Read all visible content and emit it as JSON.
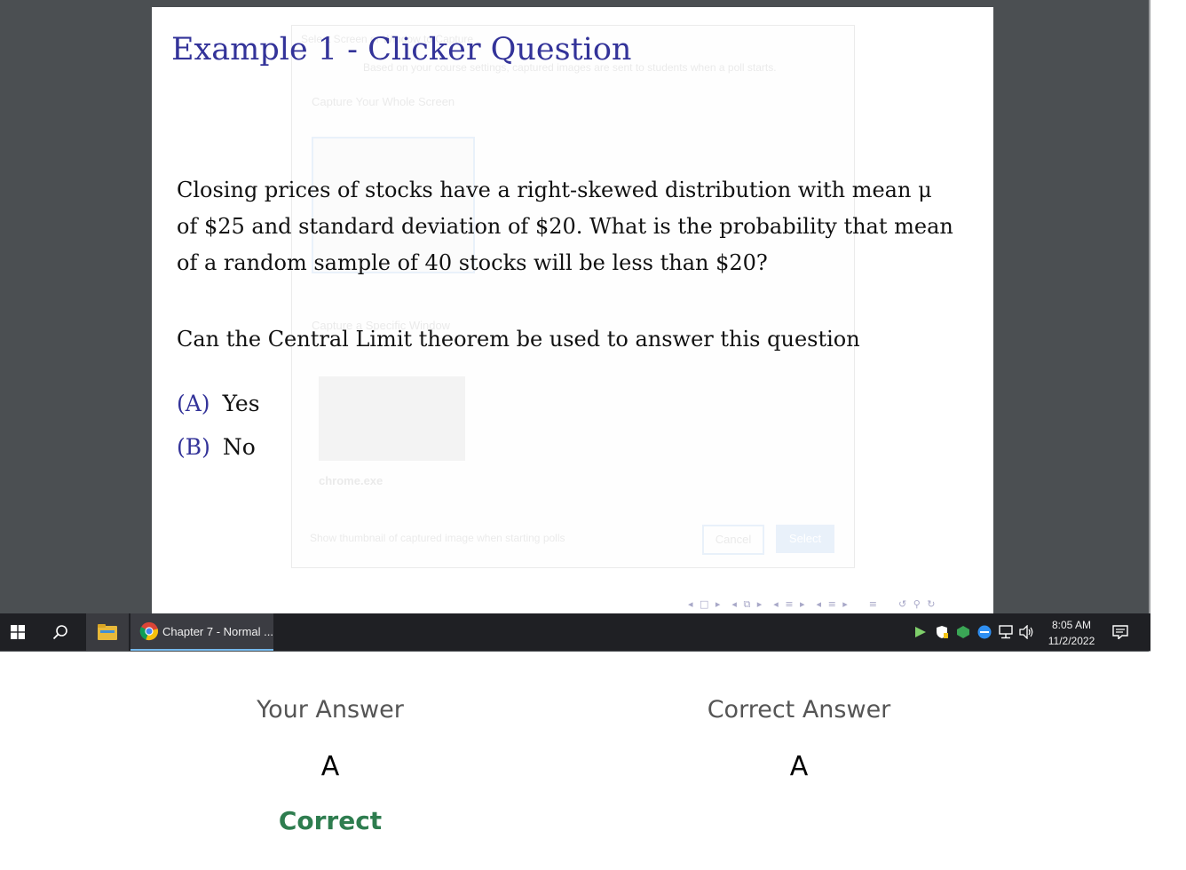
{
  "slide": {
    "title": "Example 1 - Clicker Question",
    "question": "Closing prices of stocks have a right-skewed distribution with mean μ of $25 and standard deviation of $20. What is the probability that mean of a random sample of 40 stocks will be less than $20?",
    "prompt": "Can the Central Limit theorem be used to answer this question",
    "choices": [
      {
        "letter": "(A)",
        "text": "Yes"
      },
      {
        "letter": "(B)",
        "text": "No"
      }
    ]
  },
  "ghost_dialog": {
    "title": "Select Screen or Window to Capture",
    "subtitle": "Based on your course settings, captured images are sent to students when a poll starts.",
    "section_whole": "Capture Your Whole Screen",
    "section_window": "Capture a Specific Window",
    "window_name": "chrome.exe",
    "checkbox_label": "Show thumbnail of captured image when starting polls",
    "cancel_label": "Cancel",
    "select_label": "Select"
  },
  "taskbar": {
    "chrome_task_label": "Chapter 7 - Normal ...",
    "time": "8:05 AM",
    "date": "11/2/2022",
    "icons": [
      "windows-start-icon",
      "search-icon",
      "file-explorer-icon",
      "chrome-icon",
      "notification-icon"
    ]
  },
  "results": {
    "your_answer_label": "Your Answer",
    "your_answer": "A",
    "correct_answer_label": "Correct Answer",
    "correct_answer": "A",
    "status": "Correct",
    "status_color": "#2e7d4f"
  },
  "colors": {
    "slide_title": "#333399",
    "taskbar": "#1f2024",
    "desktop": "#4b4f52"
  }
}
